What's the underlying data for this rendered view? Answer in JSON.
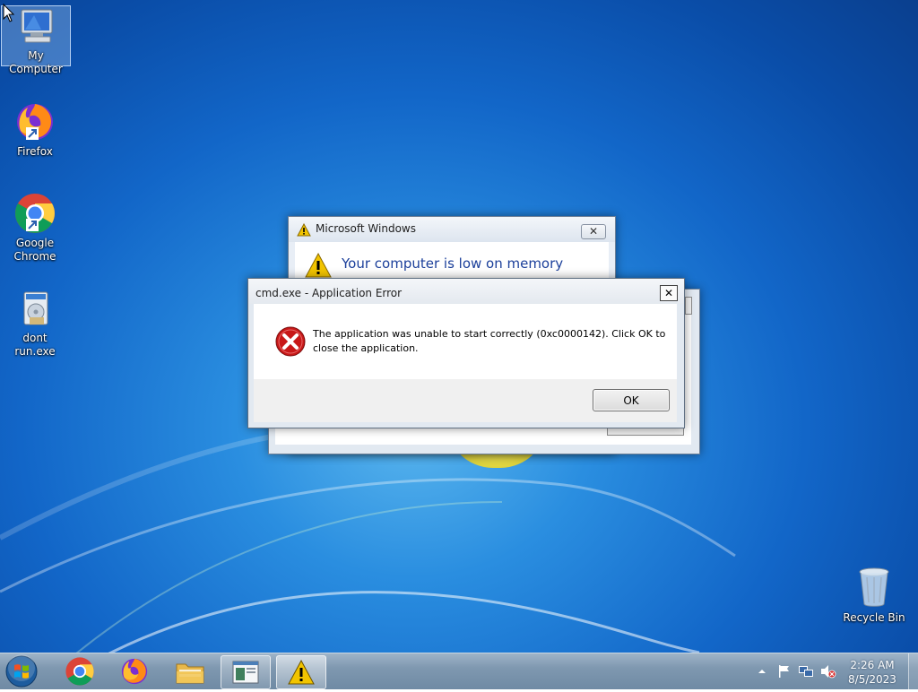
{
  "desktop": {
    "icons": [
      {
        "label": "My Computer"
      },
      {
        "label": "Firefox"
      },
      {
        "label": "Google Chrome"
      },
      {
        "label": "dont run.exe"
      },
      {
        "label": "Recycle Bin"
      }
    ]
  },
  "memory_dialog": {
    "title": "Microsoft Windows",
    "heading": "Your computer is low on memory",
    "close_glyph": "✕"
  },
  "error_dialog": {
    "title": "cmd.exe - Application Error",
    "message_line1": "The application was unable to start correctly (0xc0000142). Click OK to",
    "message_line2": "close the application.",
    "ok_label": "OK",
    "close_glyph": "✕"
  },
  "taskbar": {
    "items": [
      "start-orb",
      "chrome",
      "firefox",
      "file-explorer",
      "dont-run-app",
      "warning-dialog"
    ],
    "active_item": "warning-dialog",
    "clock": {
      "time": "2:26 AM",
      "date": "8/5/2023"
    }
  },
  "colors": {
    "heading_blue": "#1b3f9a",
    "error_red": "#c81818",
    "warning_yellow": "#f2c400"
  }
}
